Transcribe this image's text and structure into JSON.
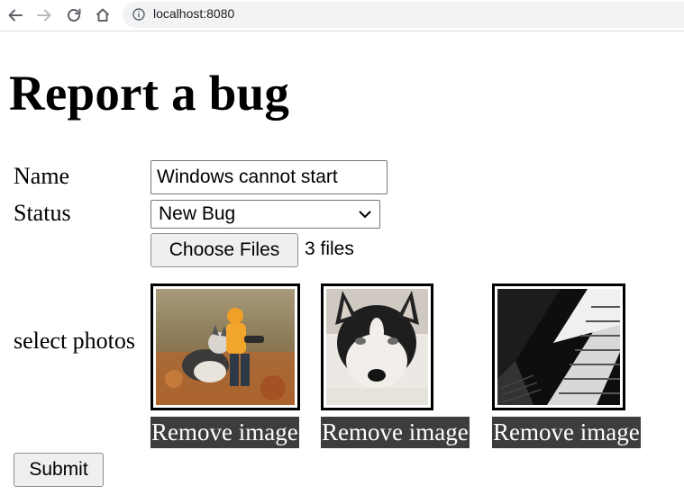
{
  "browser": {
    "url": "localhost:8080",
    "icons": [
      "back-icon",
      "forward-icon",
      "reload-icon",
      "home-icon",
      "info-icon"
    ]
  },
  "page": {
    "title": "Report a bug",
    "form": {
      "name_label": "Name",
      "name_value": "Windows cannot start",
      "status_label": "Status",
      "status_value": "New Bug",
      "file_button_label": "Choose Files",
      "file_count_text": "3 files",
      "photos_label": "select photos",
      "photos": [
        {
          "subject": "child with husky dog in autumn leaves",
          "remove_label": "Remove image"
        },
        {
          "subject": "husky dog close-up lying down",
          "remove_label": "Remove image"
        },
        {
          "subject": "black and white building looking up",
          "remove_label": "Remove image"
        }
      ],
      "submit_label": "Submit"
    }
  },
  "colors": {
    "remove_button_bg": "#3d3d3d",
    "address_bar_bg": "#f1f3f4"
  }
}
